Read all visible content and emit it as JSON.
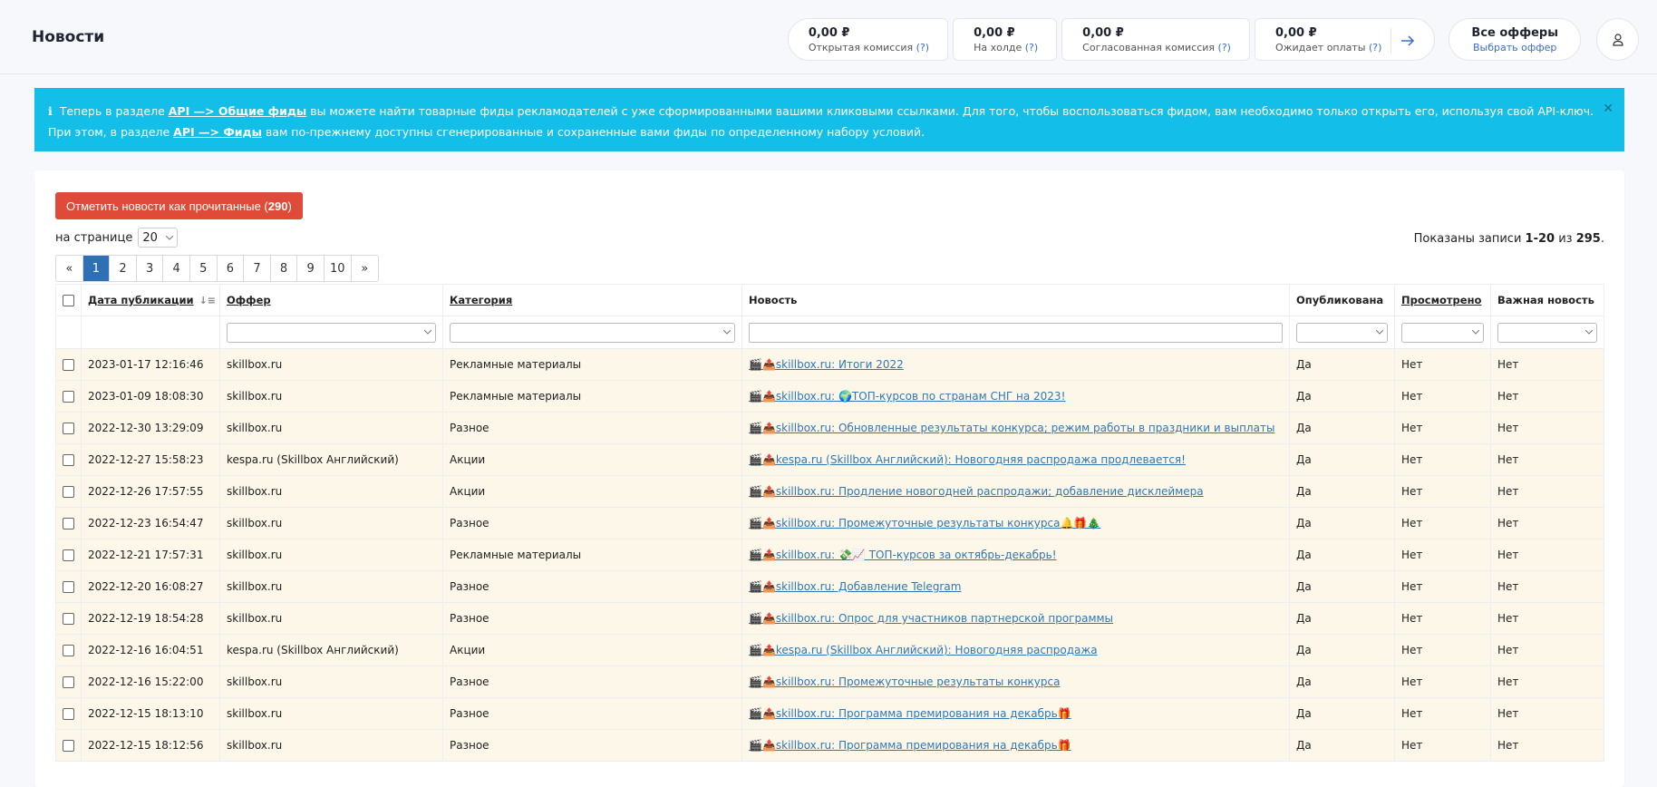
{
  "header": {
    "title": "Новости",
    "stats": [
      {
        "value": "0,00 ₽",
        "label": "Открытая комиссия",
        "q": "(?)"
      },
      {
        "value": "0,00 ₽",
        "label": "На холде",
        "q": "(?)"
      },
      {
        "value": "0,00 ₽",
        "label": "Согласованная комиссия",
        "q": "(?)"
      },
      {
        "value": "0,00 ₽",
        "label": "Ожидает оплаты",
        "q": "(?)"
      }
    ],
    "offers_title": "Все офферы",
    "offers_link": "Выбрать оффер"
  },
  "alert": {
    "line1_pre": "Теперь в разделе ",
    "line1_link": "API —> Общие фиды",
    "line1_post": " вы можете найти товарные фиды рекламодателей с уже сформированными вашими кликовыми ссылками. Для того, чтобы воспользоваться фидом, вам необходимо только открыть его, используя свой API-ключ.",
    "line2_pre": "При этом, в разделе ",
    "line2_link": "API —> Фиды",
    "line2_post": " вам по-прежнему доступны сгенерированные и сохраненные вами фиды по определенному набору условий."
  },
  "toolbar": {
    "mark_read_label": "Отметить новости как прочитанные (",
    "mark_read_count": "290",
    "mark_read_close": ")",
    "per_page_label": "на странице",
    "per_page_value": "20",
    "shown_pre": "Показаны записи ",
    "shown_range": "1-20",
    "shown_mid": " из ",
    "shown_total": "295",
    "shown_end": "."
  },
  "pagination": [
    "«",
    "1",
    "2",
    "3",
    "4",
    "5",
    "6",
    "7",
    "8",
    "9",
    "10",
    "»"
  ],
  "table": {
    "headers": {
      "date": "Дата публикации",
      "offer": "Оффер",
      "category": "Категория",
      "news": "Новость",
      "published": "Опубликована",
      "viewed": "Просмотрено",
      "important": "Важная новость"
    },
    "rows": [
      {
        "date": "2023-01-17 12:16:46",
        "offer": "skillbox.ru",
        "category": "Рекламные материалы",
        "news": "🎬📤skillbox.ru: Итоги 2022",
        "published": "Да",
        "viewed": "Нет",
        "important": "Нет"
      },
      {
        "date": "2023-01-09 18:08:30",
        "offer": "skillbox.ru",
        "category": "Рекламные материалы",
        "news": "🎬📤skillbox.ru: 🌍ТОП-курсов по странам СНГ на 2023!",
        "published": "Да",
        "viewed": "Нет",
        "important": "Нет"
      },
      {
        "date": "2022-12-30 13:29:09",
        "offer": "skillbox.ru",
        "category": "Разное",
        "news": "🎬📤skillbox.ru: Обновленные результаты конкурса; режим работы в праздники и выплаты",
        "published": "Да",
        "viewed": "Нет",
        "important": "Нет"
      },
      {
        "date": "2022-12-27 15:58:23",
        "offer": "kespa.ru (Skillbox Английский)",
        "category": "Акции",
        "news": "🎬📤kespa.ru (Skillbox Английский): Новогодняя распродажа продлевается!",
        "published": "Да",
        "viewed": "Нет",
        "important": "Нет"
      },
      {
        "date": "2022-12-26 17:57:55",
        "offer": "skillbox.ru",
        "category": "Акции",
        "news": "🎬📤skillbox.ru: Продление новогодней распродажи; добавление дисклеймера",
        "published": "Да",
        "viewed": "Нет",
        "important": "Нет"
      },
      {
        "date": "2022-12-23 16:54:47",
        "offer": "skillbox.ru",
        "category": "Разное",
        "news": "🎬📤skillbox.ru: Промежуточные результаты конкурса🔔🎁🎄",
        "published": "Да",
        "viewed": "Нет",
        "important": "Нет"
      },
      {
        "date": "2022-12-21 17:57:31",
        "offer": "skillbox.ru",
        "category": "Рекламные материалы",
        "news": "🎬📤skillbox.ru: 💸📈 ТОП-курсов за октябрь-декабрь!",
        "published": "Да",
        "viewed": "Нет",
        "important": "Нет"
      },
      {
        "date": "2022-12-20 16:08:27",
        "offer": "skillbox.ru",
        "category": "Разное",
        "news": "🎬📤skillbox.ru: Добавление Telegram",
        "published": "Да",
        "viewed": "Нет",
        "important": "Нет"
      },
      {
        "date": "2022-12-19 18:54:28",
        "offer": "skillbox.ru",
        "category": "Разное",
        "news": "🎬📤skillbox.ru: Опрос для участников партнерской программы",
        "published": "Да",
        "viewed": "Нет",
        "important": "Нет"
      },
      {
        "date": "2022-12-16 16:04:51",
        "offer": "kespa.ru (Skillbox Английский)",
        "category": "Акции",
        "news": "🎬📤kespa.ru (Skillbox Английский): Новогодняя распродажа",
        "published": "Да",
        "viewed": "Нет",
        "important": "Нет"
      },
      {
        "date": "2022-12-16 15:22:00",
        "offer": "skillbox.ru",
        "category": "Разное",
        "news": "🎬📤skillbox.ru: Промежуточные результаты конкурса",
        "published": "Да",
        "viewed": "Нет",
        "important": "Нет"
      },
      {
        "date": "2022-12-15 18:13:10",
        "offer": "skillbox.ru",
        "category": "Разное",
        "news": "🎬📤skillbox.ru: Программа премирования на декабрь🎁",
        "published": "Да",
        "viewed": "Нет",
        "important": "Нет"
      },
      {
        "date": "2022-12-15 18:12:56",
        "offer": "skillbox.ru",
        "category": "Разное",
        "news": "🎬📤skillbox.ru: Программа премирования на декабрь🎁",
        "published": "Да",
        "viewed": "Нет",
        "important": "Нет"
      }
    ]
  }
}
